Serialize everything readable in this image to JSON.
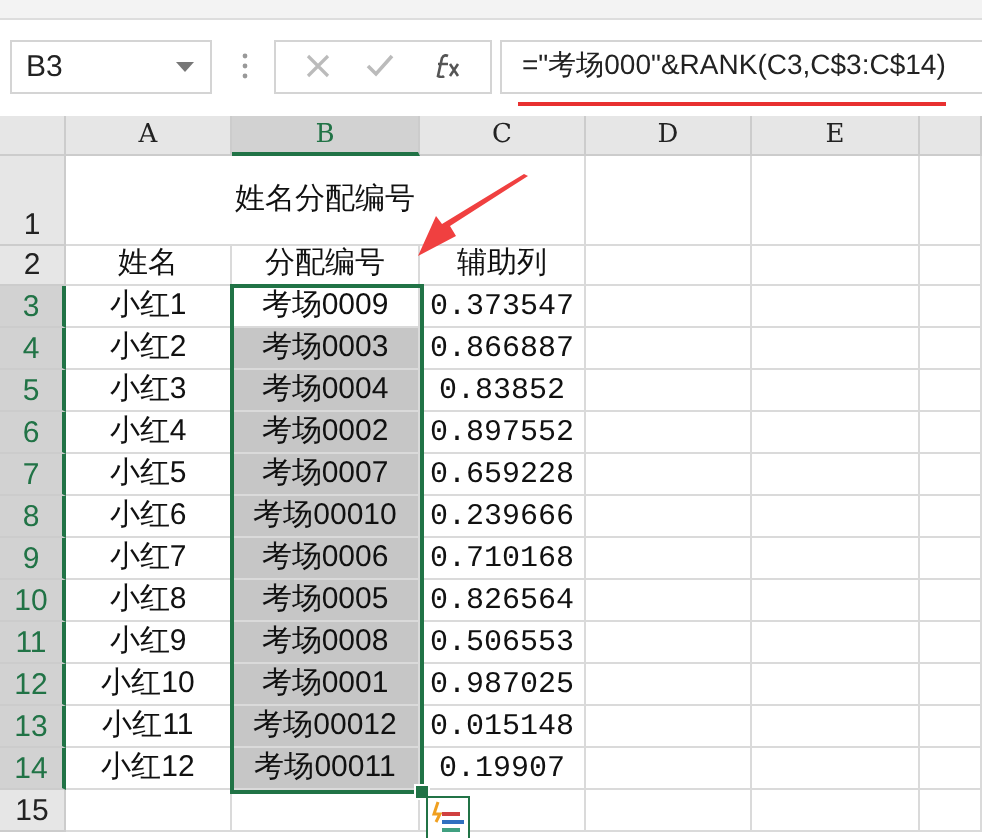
{
  "name_box": {
    "value": "B3"
  },
  "formula_bar": {
    "formula": "=\"考场000\"&RANK(C3,C$3:C$14)",
    "underlined": true
  },
  "columns": [
    {
      "label": "A",
      "selected": false
    },
    {
      "label": "B",
      "selected": true
    },
    {
      "label": "C",
      "selected": false
    },
    {
      "label": "D",
      "selected": false
    },
    {
      "label": "E",
      "selected": false
    }
  ],
  "title_row": {
    "number": "1",
    "selected": false,
    "title": "姓名分配编号"
  },
  "header_row": {
    "number": "2",
    "selected": false,
    "cells": [
      "姓名",
      "分配编号",
      "辅助列"
    ]
  },
  "rows": [
    {
      "number": "3",
      "selected": true,
      "active": true,
      "name": "小红1",
      "code": "考场0009",
      "code_selected": true,
      "aux": "0.373547"
    },
    {
      "number": "4",
      "selected": true,
      "active": false,
      "name": "小红2",
      "code": "考场0003",
      "code_selected": true,
      "aux": "0.866887"
    },
    {
      "number": "5",
      "selected": true,
      "active": false,
      "name": "小红3",
      "code": "考场0004",
      "code_selected": true,
      "aux": "0.83852"
    },
    {
      "number": "6",
      "selected": true,
      "active": false,
      "name": "小红4",
      "code": "考场0002",
      "code_selected": true,
      "aux": "0.897552"
    },
    {
      "number": "7",
      "selected": true,
      "active": false,
      "name": "小红5",
      "code": "考场0007",
      "code_selected": true,
      "aux": "0.659228"
    },
    {
      "number": "8",
      "selected": true,
      "active": false,
      "name": "小红6",
      "code": "考场00010",
      "code_selected": true,
      "aux": "0.239666"
    },
    {
      "number": "9",
      "selected": true,
      "active": false,
      "name": "小红7",
      "code": "考场0006",
      "code_selected": true,
      "aux": "0.710168"
    },
    {
      "number": "10",
      "selected": true,
      "active": false,
      "name": "小红8",
      "code": "考场0005",
      "code_selected": true,
      "aux": "0.826564"
    },
    {
      "number": "11",
      "selected": true,
      "active": false,
      "name": "小红9",
      "code": "考场0008",
      "code_selected": true,
      "aux": "0.506553"
    },
    {
      "number": "12",
      "selected": true,
      "active": false,
      "name": "小红10",
      "code": "考场0001",
      "code_selected": true,
      "aux": "0.987025"
    },
    {
      "number": "13",
      "selected": true,
      "active": false,
      "name": "小红11",
      "code": "考场00012",
      "code_selected": true,
      "aux": "0.015148"
    },
    {
      "number": "14",
      "selected": true,
      "active": false,
      "name": "小红12",
      "code": "考场00011",
      "code_selected": true,
      "aux": "0.19907"
    }
  ],
  "empty_row": {
    "number": "15",
    "selected": false
  }
}
